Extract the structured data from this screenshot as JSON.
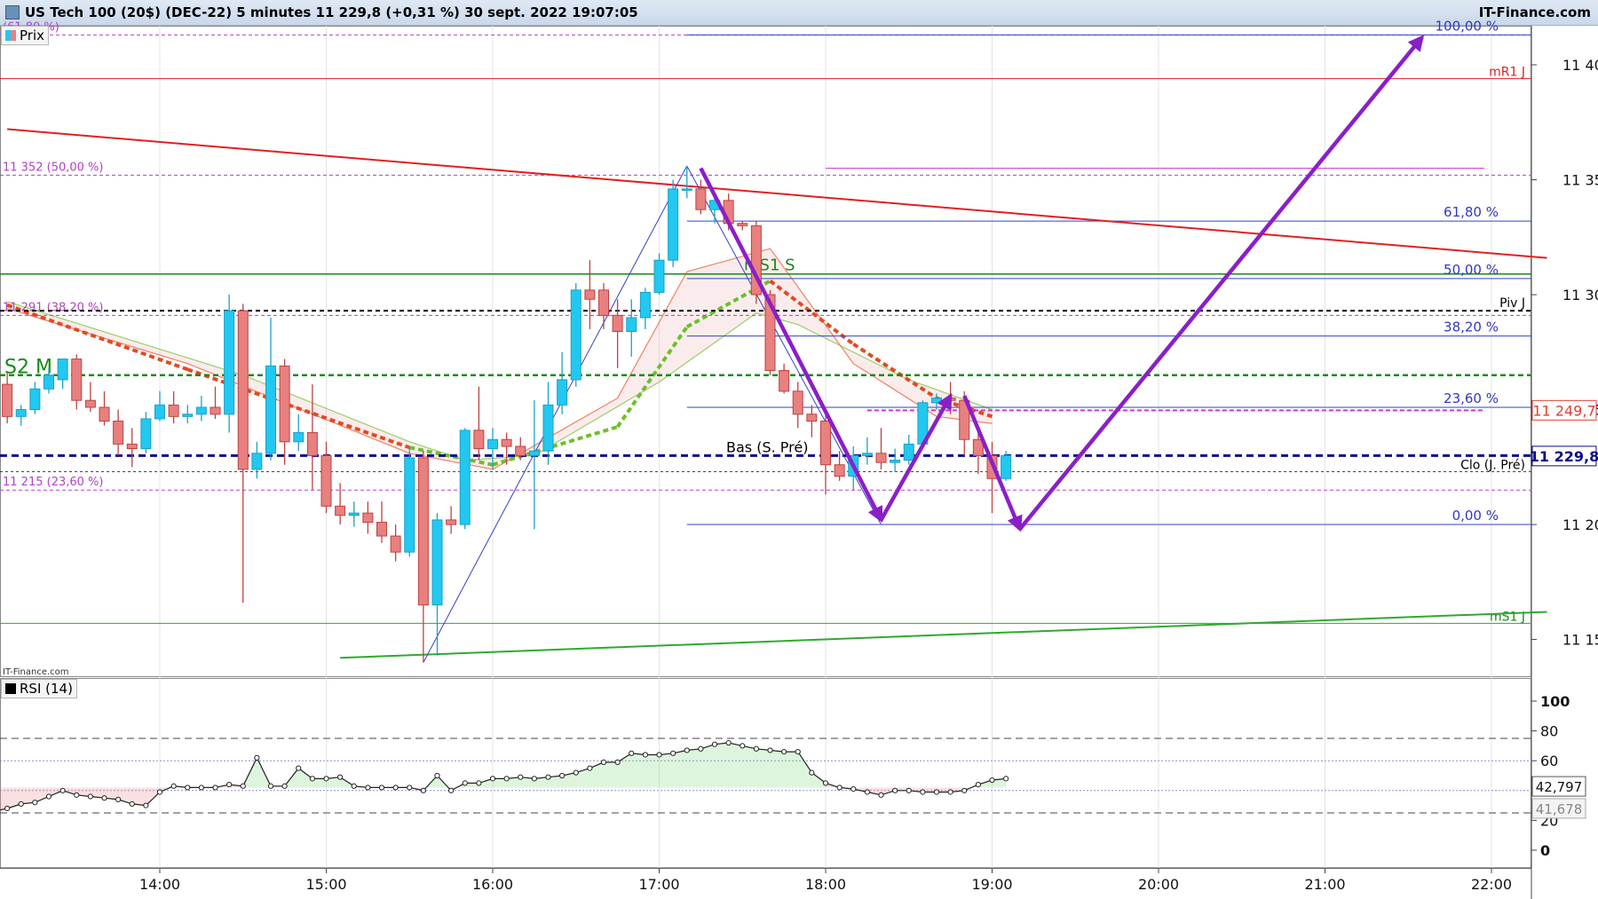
{
  "header": {
    "title": "US Tech 100 (20$) (DEC-22) 5 minutes 11 229,8 (+0,31 %) 30 sept. 2022 19:07:05",
    "brand": "IT-Finance.com"
  },
  "panels": {
    "price_legend": "Prix",
    "rsi_legend": "RSI (14)",
    "watermark": "IT-Finance.com"
  },
  "colors": {
    "up": "#22c8f0",
    "down": "#dd5a5a",
    "down_fill": "#e88080",
    "fib_line": "#3340c8",
    "fib_text": "#3038c0",
    "pivot_fib": "#b040c8",
    "resistance": "#e02020",
    "support": "#2fa92f",
    "ma_red": "#e24a22",
    "ma_green": "#6cbf2b",
    "projection": "#8a1fc8"
  },
  "chart_data": [
    {
      "type": "candlestick",
      "title": "US Tech 100 (20$) (DEC-22) 5 minutes",
      "xlabel": "",
      "ylabel": "",
      "x_ticks": [
        "14:00",
        "15:00",
        "16:00",
        "17:00",
        "18:00",
        "19:00",
        "20:00",
        "21:00",
        "22:00"
      ],
      "y_ticks": [
        "11 150",
        "11 200",
        "11 250",
        "11 300",
        "11 350",
        "11 400"
      ],
      "ylim": [
        11134,
        11417
      ],
      "candles": [
        {
          "t": "13:05",
          "o": 11261,
          "h": 11266,
          "l": 11244,
          "c": 11247
        },
        {
          "t": "13:10",
          "o": 11247,
          "h": 11252,
          "l": 11243,
          "c": 11250
        },
        {
          "t": "13:15",
          "o": 11250,
          "h": 11262,
          "l": 11248,
          "c": 11259
        },
        {
          "t": "13:20",
          "o": 11259,
          "h": 11268,
          "l": 11257,
          "c": 11265
        },
        {
          "t": "13:25",
          "o": 11263,
          "h": 11272,
          "l": 11259,
          "c": 11272
        },
        {
          "t": "13:30",
          "o": 11272,
          "h": 11274,
          "l": 11250,
          "c": 11254
        },
        {
          "t": "13:35",
          "o": 11254,
          "h": 11262,
          "l": 11249,
          "c": 11251
        },
        {
          "t": "13:40",
          "o": 11251,
          "h": 11258,
          "l": 11243,
          "c": 11245
        },
        {
          "t": "13:45",
          "o": 11245,
          "h": 11250,
          "l": 11230,
          "c": 11235
        },
        {
          "t": "13:50",
          "o": 11235,
          "h": 11242,
          "l": 11225,
          "c": 11233
        },
        {
          "t": "13:55",
          "o": 11233,
          "h": 11249,
          "l": 11231,
          "c": 11246
        },
        {
          "t": "14:00",
          "o": 11246,
          "h": 11258,
          "l": 11245,
          "c": 11252
        },
        {
          "t": "14:05",
          "o": 11252,
          "h": 11258,
          "l": 11244,
          "c": 11247
        },
        {
          "t": "14:10",
          "o": 11247,
          "h": 11252,
          "l": 11244,
          "c": 11248
        },
        {
          "t": "14:15",
          "o": 11248,
          "h": 11256,
          "l": 11245,
          "c": 11251
        },
        {
          "t": "14:20",
          "o": 11251,
          "h": 11260,
          "l": 11246,
          "c": 11248
        },
        {
          "t": "14:25",
          "o": 11248,
          "h": 11300,
          "l": 11240,
          "c": 11293
        },
        {
          "t": "14:30",
          "o": 11293,
          "h": 11296,
          "l": 11166,
          "c": 11224
        },
        {
          "t": "14:35",
          "o": 11224,
          "h": 11236,
          "l": 11220,
          "c": 11231
        },
        {
          "t": "14:40",
          "o": 11231,
          "h": 11290,
          "l": 11228,
          "c": 11269
        },
        {
          "t": "14:45",
          "o": 11269,
          "h": 11272,
          "l": 11226,
          "c": 11236
        },
        {
          "t": "14:50",
          "o": 11236,
          "h": 11248,
          "l": 11232,
          "c": 11240
        },
        {
          "t": "14:55",
          "o": 11240,
          "h": 11261,
          "l": 11215,
          "c": 11230
        },
        {
          "t": "15:00",
          "o": 11230,
          "h": 11236,
          "l": 11205,
          "c": 11208
        },
        {
          "t": "15:05",
          "o": 11208,
          "h": 11218,
          "l": 11200,
          "c": 11204
        },
        {
          "t": "15:10",
          "o": 11204,
          "h": 11210,
          "l": 11199,
          "c": 11205
        },
        {
          "t": "15:15",
          "o": 11205,
          "h": 11210,
          "l": 11196,
          "c": 11201
        },
        {
          "t": "15:20",
          "o": 11201,
          "h": 11210,
          "l": 11192,
          "c": 11195
        },
        {
          "t": "15:25",
          "o": 11195,
          "h": 11200,
          "l": 11184,
          "c": 11188
        },
        {
          "t": "15:30",
          "o": 11188,
          "h": 11234,
          "l": 11186,
          "c": 11229
        },
        {
          "t": "15:35",
          "o": 11229,
          "h": 11232,
          "l": 11140,
          "c": 11165
        },
        {
          "t": "15:40",
          "o": 11165,
          "h": 11205,
          "l": 11143,
          "c": 11202
        },
        {
          "t": "15:45",
          "o": 11202,
          "h": 11208,
          "l": 11196,
          "c": 11200
        },
        {
          "t": "15:50",
          "o": 11200,
          "h": 11242,
          "l": 11198,
          "c": 11241
        },
        {
          "t": "15:55",
          "o": 11241,
          "h": 11260,
          "l": 11228,
          "c": 11233
        },
        {
          "t": "16:00",
          "o": 11233,
          "h": 11242,
          "l": 11224,
          "c": 11237
        },
        {
          "t": "16:05",
          "o": 11237,
          "h": 11240,
          "l": 11226,
          "c": 11234
        },
        {
          "t": "16:10",
          "o": 11234,
          "h": 11238,
          "l": 11228,
          "c": 11230
        },
        {
          "t": "16:15",
          "o": 11230,
          "h": 11254,
          "l": 11198,
          "c": 11232
        },
        {
          "t": "16:20",
          "o": 11232,
          "h": 11262,
          "l": 11226,
          "c": 11252
        },
        {
          "t": "16:25",
          "o": 11252,
          "h": 11275,
          "l": 11248,
          "c": 11263
        },
        {
          "t": "16:30",
          "o": 11263,
          "h": 11305,
          "l": 11260,
          "c": 11302
        },
        {
          "t": "16:35",
          "o": 11302,
          "h": 11315,
          "l": 11285,
          "c": 11298
        },
        {
          "t": "16:40",
          "o": 11302,
          "h": 11305,
          "l": 11285,
          "c": 11291
        },
        {
          "t": "16:45",
          "o": 11291,
          "h": 11298,
          "l": 11268,
          "c": 11284
        },
        {
          "t": "16:50",
          "o": 11284,
          "h": 11298,
          "l": 11273,
          "c": 11290
        },
        {
          "t": "16:55",
          "o": 11290,
          "h": 11303,
          "l": 11285,
          "c": 11301
        },
        {
          "t": "17:00",
          "o": 11301,
          "h": 11318,
          "l": 11300,
          "c": 11315
        },
        {
          "t": "17:05",
          "o": 11315,
          "h": 11350,
          "l": 11312,
          "c": 11346
        },
        {
          "t": "17:10",
          "o": 11346,
          "h": 11356,
          "l": 11342,
          "c": 11346
        },
        {
          "t": "17:15",
          "o": 11346,
          "h": 11350,
          "l": 11335,
          "c": 11337
        },
        {
          "t": "17:20",
          "o": 11337,
          "h": 11343,
          "l": 11331,
          "c": 11341
        },
        {
          "t": "17:25",
          "o": 11341,
          "h": 11344,
          "l": 11328,
          "c": 11331
        },
        {
          "t": "17:30",
          "o": 11331,
          "h": 11332,
          "l": 11328,
          "c": 11330
        },
        {
          "t": "17:35",
          "o": 11330,
          "h": 11332,
          "l": 11296,
          "c": 11300
        },
        {
          "t": "17:40",
          "o": 11300,
          "h": 11302,
          "l": 11265,
          "c": 11267
        },
        {
          "t": "17:45",
          "o": 11267,
          "h": 11270,
          "l": 11257,
          "c": 11258
        },
        {
          "t": "17:50",
          "o": 11258,
          "h": 11262,
          "l": 11242,
          "c": 11248
        },
        {
          "t": "17:55",
          "o": 11248,
          "h": 11252,
          "l": 11238,
          "c": 11245
        },
        {
          "t": "18:00",
          "o": 11245,
          "h": 11248,
          "l": 11213,
          "c": 11226
        },
        {
          "t": "18:05",
          "o": 11226,
          "h": 11232,
          "l": 11219,
          "c": 11221
        },
        {
          "t": "18:10",
          "o": 11221,
          "h": 11234,
          "l": 11215,
          "c": 11230
        },
        {
          "t": "18:15",
          "o": 11230,
          "h": 11238,
          "l": 11226,
          "c": 11231
        },
        {
          "t": "18:20",
          "o": 11231,
          "h": 11242,
          "l": 11224,
          "c": 11227
        },
        {
          "t": "18:25",
          "o": 11227,
          "h": 11233,
          "l": 11223,
          "c": 11228
        },
        {
          "t": "18:30",
          "o": 11228,
          "h": 11239,
          "l": 11226,
          "c": 11235
        },
        {
          "t": "18:35",
          "o": 11235,
          "h": 11254,
          "l": 11233,
          "c": 11253
        },
        {
          "t": "18:40",
          "o": 11253,
          "h": 11257,
          "l": 11250,
          "c": 11255
        },
        {
          "t": "18:45",
          "o": 11255,
          "h": 11262,
          "l": 11248,
          "c": 11254
        },
        {
          "t": "18:50",
          "o": 11254,
          "h": 11258,
          "l": 11230,
          "c": 11237
        },
        {
          "t": "18:55",
          "o": 11237,
          "h": 11241,
          "l": 11222,
          "c": 11230
        },
        {
          "t": "19:00",
          "o": 11230,
          "h": 11236,
          "l": 11205,
          "c": 11220
        },
        {
          "t": "19:05",
          "o": 11220,
          "h": 11232,
          "l": 11219,
          "c": 11230
        }
      ],
      "overlays": {
        "ma_fast": [
          {
            "t": "13:05",
            "v": 11294
          },
          {
            "t": "14:10",
            "v": 11270
          },
          {
            "t": "15:30",
            "v": 11231
          },
          {
            "t": "16:00",
            "v": 11224
          },
          {
            "t": "16:45",
            "v": 11255
          },
          {
            "t": "17:10",
            "v": 11310
          },
          {
            "t": "17:40",
            "v": 11320
          },
          {
            "t": "18:10",
            "v": 11270
          },
          {
            "t": "18:40",
            "v": 11247
          },
          {
            "t": "19:00",
            "v": 11244
          }
        ],
        "ma_slow": [
          {
            "t": "13:05",
            "v": 11297
          },
          {
            "t": "14:30",
            "v": 11265
          },
          {
            "t": "15:30",
            "v": 11236
          },
          {
            "t": "15:50",
            "v": 11228
          },
          {
            "t": "16:15",
            "v": 11230
          },
          {
            "t": "17:00",
            "v": 11262
          },
          {
            "t": "17:35",
            "v": 11292
          },
          {
            "t": "17:50",
            "v": 11287
          },
          {
            "t": "18:30",
            "v": 11263
          },
          {
            "t": "19:00",
            "v": 11250
          }
        ],
        "trend_lines": [
          {
            "name": "resistance",
            "from": {
              "t": "13:05",
              "v": 11372
            },
            "to": {
              "t": "22:20",
              "v": 11316
            }
          },
          {
            "name": "support",
            "from": {
              "t": "15:05",
              "v": 11142
            },
            "to": {
              "t": "22:20",
              "v": 11162
            }
          },
          {
            "name": "swing-up",
            "from": {
              "t": "15:35",
              "v": 11140
            },
            "to": {
              "t": "17:10",
              "v": 11356
            }
          },
          {
            "name": "swing-down",
            "from": {
              "t": "17:10",
              "v": 11356
            },
            "to": {
              "t": "18:20",
              "v": 11200
            }
          }
        ],
        "projection_arrows": [
          {
            "from": {
              "t": "17:15",
              "v": 11355
            },
            "to": {
              "t": "18:20",
              "v": 11202
            }
          },
          {
            "from": {
              "t": "18:20",
              "v": 11202
            },
            "to": {
              "t": "18:45",
              "v": 11256
            }
          },
          {
            "from": {
              "t": "18:50",
              "v": 11256
            },
            "to": {
              "t": "19:10",
              "v": 11198
            }
          },
          {
            "from": {
              "t": "19:10",
              "v": 11198
            },
            "to": {
              "t": "21:35",
              "v": 11412
            }
          }
        ],
        "fibonacci": {
          "t_start": "17:10",
          "t_end": "22:15",
          "levels": [
            {
              "label": "100,00 %",
              "v": 11413
            },
            {
              "label": "61,80 %",
              "v": 11332
            },
            {
              "label": "50,00 %",
              "v": 11307
            },
            {
              "label": "38,20 %",
              "v": 11282
            },
            {
              "label": "23,60 %",
              "v": 11251
            },
            {
              "label": "0,00 %",
              "v": 11200
            }
          ]
        },
        "pivot_levels": [
          {
            "label": "(61,80 %)",
            "v": 11413
          },
          {
            "label": "11 352 (50,00 %)",
            "v": 11352
          },
          {
            "label": "11 291 (38,20 %)",
            "v": 11291
          },
          {
            "label": "11 215 (23,60 %)",
            "v": 11215
          }
        ],
        "horizontal_levels": [
          {
            "label": "mR1 J",
            "v": 11394
          },
          {
            "label": "mS1 S",
            "v": 11309
          },
          {
            "label": "Piv J",
            "v": 11293
          },
          {
            "label": "S2 M",
            "v": 11265
          },
          {
            "label": "Bas (S. Pré)",
            "v": 11230
          },
          {
            "label": "Clo (J. Pré)",
            "v": 11223
          },
          {
            "label": "mS1 J",
            "v": 11157
          }
        ],
        "price_tags": [
          {
            "label": "11 249,7",
            "v": 11249.7
          },
          {
            "label": "11 229,8",
            "v": 11229.8
          }
        ]
      }
    },
    {
      "type": "line",
      "title": "RSI (14)",
      "xlabel": "",
      "ylabel": "",
      "ylim": [
        0,
        100
      ],
      "y_ticks": [
        "0",
        "20",
        "60",
        "80",
        "100"
      ],
      "reference_levels": [
        25,
        40,
        60,
        75
      ],
      "current_values": [
        "42,797",
        "41,678"
      ],
      "x": [
        "13:00",
        "13:05",
        "13:10",
        "13:15",
        "13:20",
        "13:25",
        "13:30",
        "13:35",
        "13:40",
        "13:45",
        "13:50",
        "13:55",
        "14:00",
        "14:05",
        "14:10",
        "14:15",
        "14:20",
        "14:25",
        "14:30",
        "14:35",
        "14:40",
        "14:45",
        "14:50",
        "14:55",
        "15:00",
        "15:05",
        "15:10",
        "15:15",
        "15:20",
        "15:25",
        "15:30",
        "15:35",
        "15:40",
        "15:45",
        "15:50",
        "15:55",
        "16:00",
        "16:05",
        "16:10",
        "16:15",
        "16:20",
        "16:25",
        "16:30",
        "16:35",
        "16:40",
        "16:45",
        "16:50",
        "16:55",
        "17:00",
        "17:05",
        "17:10",
        "17:15",
        "17:20",
        "17:25",
        "17:30",
        "17:35",
        "17:40",
        "17:45",
        "17:50",
        "17:55",
        "18:00",
        "18:05",
        "18:10",
        "18:15",
        "18:20",
        "18:25",
        "18:30",
        "18:35",
        "18:40",
        "18:45",
        "18:50",
        "18:55",
        "19:00",
        "19:05"
      ],
      "series": [
        {
          "name": "RSI (14)",
          "values": [
            26,
            28,
            31,
            32,
            36,
            40,
            37,
            36,
            35,
            34,
            31,
            30,
            39,
            43,
            42,
            42,
            42,
            44,
            43,
            62,
            43,
            43,
            55,
            48,
            48,
            49,
            43,
            42,
            42,
            42,
            42,
            40,
            50,
            40,
            45,
            45,
            48,
            48,
            49,
            48,
            49,
            50,
            52,
            55,
            59,
            59,
            65,
            64,
            64,
            65,
            67,
            68,
            71,
            72,
            70,
            68,
            67,
            66,
            66,
            52,
            45,
            42,
            41,
            39,
            37,
            40,
            40,
            39,
            39,
            39,
            40,
            44,
            47,
            48,
            47,
            47,
            43,
            42,
            40,
            44
          ]
        }
      ]
    }
  ]
}
